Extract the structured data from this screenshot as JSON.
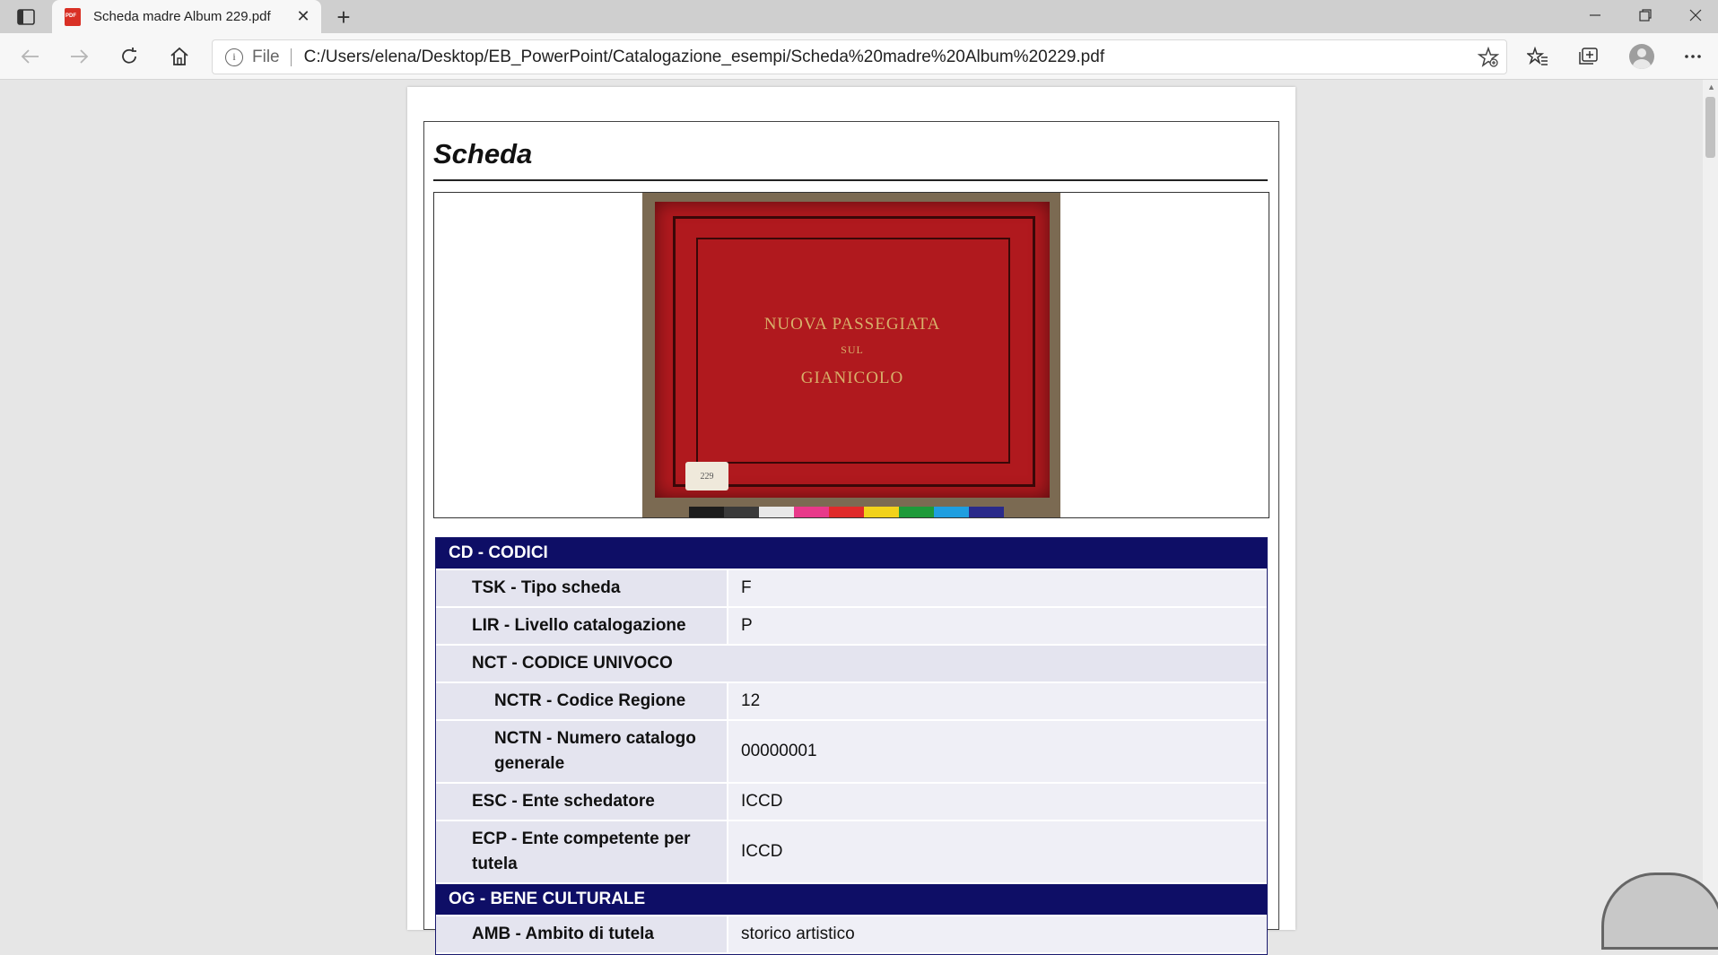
{
  "browser": {
    "tab_title": "Scheda madre Album 229.pdf",
    "address_scheme_label": "File",
    "url": "C:/Users/elena/Desktop/EB_PowerPoint/Catalogazione_esempi/Scheda%20madre%20Album%20229.pdf"
  },
  "icons": [
    "tab-actions-icon",
    "pdf-file-icon",
    "close-icon",
    "plus-icon",
    "minimize-icon",
    "restore-icon",
    "window-close-icon",
    "back-icon",
    "forward-icon",
    "refresh-icon",
    "home-icon",
    "info-icon",
    "add-favorite-icon",
    "favorites-icon",
    "collections-icon",
    "profile-avatar",
    "more-icon"
  ],
  "document": {
    "heading": "Scheda",
    "photo": {
      "cover_title_line1": "NUOVA PASSEGIATA",
      "cover_title_line2": "SUL",
      "cover_title_line3": "GIANICOLO",
      "label_number": "229",
      "color_chart": [
        "#1c1c1c",
        "#3a3a3a",
        "#e8e8e8",
        "#e8398a",
        "#e02a2a",
        "#f2d21b",
        "#1e9a3a",
        "#1f9ee0",
        "#2a2a8a"
      ]
    },
    "sections": [
      {
        "title": "CD - CODICI",
        "rows": [
          {
            "key": "TSK - Tipo scheda",
            "value": "F",
            "level": 1
          },
          {
            "key": "LIR - Livello catalogazione",
            "value": "P",
            "level": 1
          },
          {
            "key": "NCT - CODICE UNIVOCO",
            "value": "",
            "level": 1,
            "full": true
          },
          {
            "key": "NCTR - Codice Regione",
            "value": "12",
            "level": 2
          },
          {
            "key": "NCTN - Numero catalogo generale",
            "value": "00000001",
            "level": 2
          },
          {
            "key": "ESC - Ente schedatore",
            "value": "ICCD",
            "level": 1
          },
          {
            "key": "ECP - Ente competente per tutela",
            "value": "ICCD",
            "level": 1
          }
        ]
      },
      {
        "title": "OG - BENE CULTURALE",
        "rows": [
          {
            "key": "AMB - Ambito di tutela",
            "value": "storico artistico",
            "level": 1
          }
        ]
      }
    ]
  }
}
